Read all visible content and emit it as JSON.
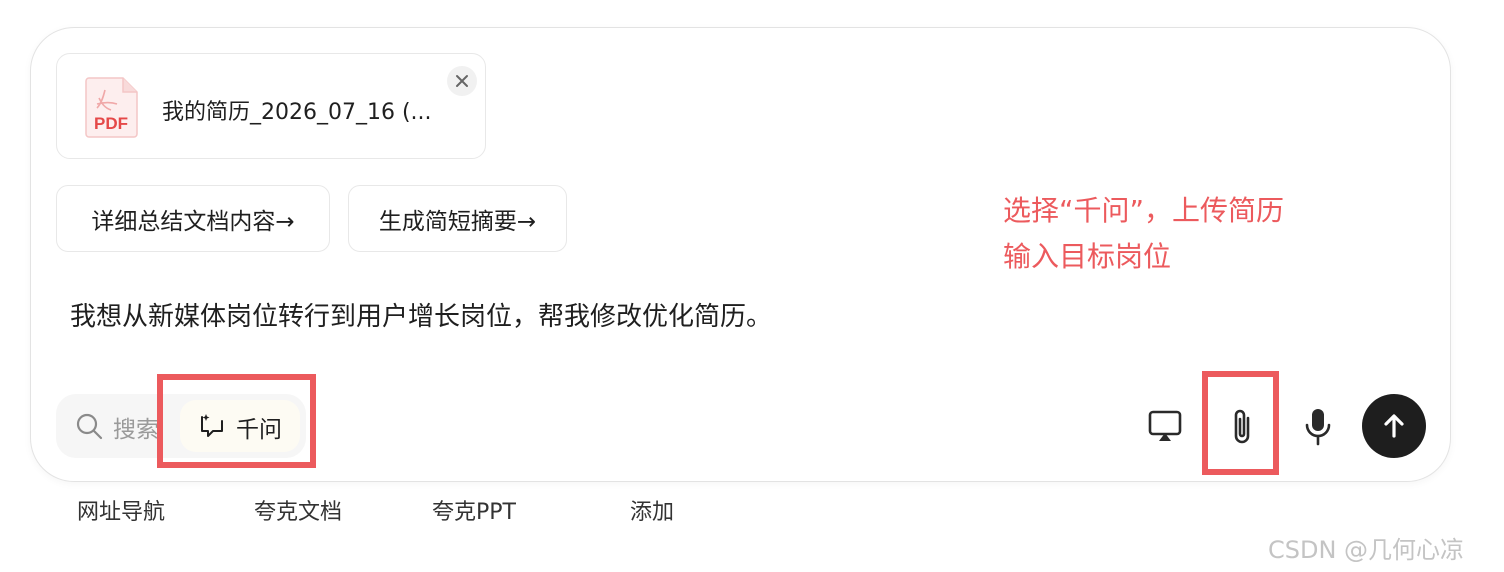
{
  "file_card": {
    "name": "我的简历_2026_07_16 (...",
    "type_label": "PDF"
  },
  "suggestions": [
    {
      "label": "详细总结文档内容→"
    },
    {
      "label": "生成简短摘要→"
    }
  ],
  "prompt": {
    "text": "我想从新媒体岗位转行到用户增长岗位，帮我修改优化简历。"
  },
  "annotation": {
    "line1": "选择“千问”，上传简历",
    "line2": "输入目标岗位",
    "color": "#ec5a5d"
  },
  "toolbar": {
    "search_label": "搜索",
    "qianwen_label": "千问",
    "icons": [
      "search-icon",
      "qianwen-icon",
      "screen-share-icon",
      "paperclip-icon",
      "microphone-icon",
      "arrow-up-icon"
    ]
  },
  "quick_links": [
    {
      "label": "网址导航"
    },
    {
      "label": "夸克文档"
    },
    {
      "label": "夸克PPT"
    },
    {
      "label": "添加"
    }
  ],
  "watermark": "CSDN @几何心凉",
  "colors": {
    "accent": "#ec5a5d",
    "send_button": "#1e1e1e",
    "text": "#1f1f1f"
  }
}
